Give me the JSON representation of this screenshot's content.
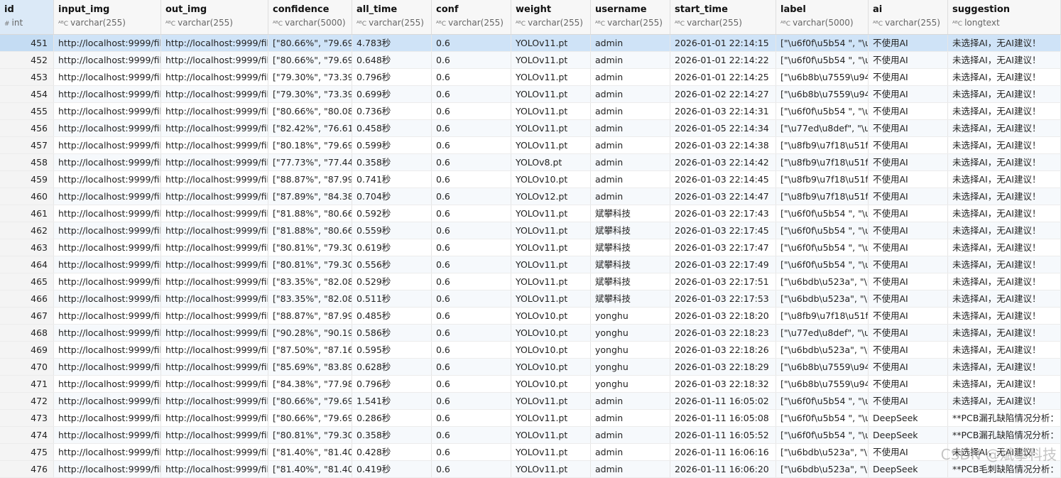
{
  "columns": [
    {
      "name": "id",
      "type": "int",
      "icon": "#"
    },
    {
      "name": "input_img",
      "type": "varchar(255)",
      "icon": "ᴬᴮC"
    },
    {
      "name": "out_img",
      "type": "varchar(255)",
      "icon": "ᴬᴮC"
    },
    {
      "name": "confidence",
      "type": "varchar(5000)",
      "icon": "ᴬᴮC"
    },
    {
      "name": "all_time",
      "type": "varchar(255)",
      "icon": "ᴬᴮC"
    },
    {
      "name": "conf",
      "type": "varchar(255)",
      "icon": "ᴬᴮC"
    },
    {
      "name": "weight",
      "type": "varchar(255)",
      "icon": "ᴬᴮC"
    },
    {
      "name": "username",
      "type": "varchar(255)",
      "icon": "ᴬᴮC"
    },
    {
      "name": "start_time",
      "type": "varchar(255)",
      "icon": "ᴬᴮC"
    },
    {
      "name": "label",
      "type": "varchar(5000)",
      "icon": "ᴬᴮC"
    },
    {
      "name": "ai",
      "type": "varchar(255)",
      "icon": "ᴬᴮC"
    },
    {
      "name": "suggestion",
      "type": "longtext",
      "icon": "ᴬᴮC"
    }
  ],
  "rows": [
    [
      "451",
      "http://localhost:9999/file",
      "http://localhost:9999/file",
      "[\"80.66%\", \"79.69%",
      "4.783秒",
      "0.6",
      "YOLOv11.pt",
      "admin",
      "2026-01-01 22:14:15",
      "[\"\\u6f0f\\u5b54 \", \"\\u6",
      "不使用AI",
      "未选择AI，无AI建议！"
    ],
    [
      "452",
      "http://localhost:9999/file",
      "http://localhost:9999/file",
      "[\"80.66%\", \"79.69%",
      "0.648秒",
      "0.6",
      "YOLOv11.pt",
      "admin",
      "2026-01-01 22:14:22",
      "[\"\\u6f0f\\u5b54 \", \"\\u6",
      "不使用AI",
      "未选择AI，无AI建议！"
    ],
    [
      "453",
      "http://localhost:9999/file",
      "http://localhost:9999/file",
      "[\"79.30%\", \"73.39%",
      "0.796秒",
      "0.6",
      "YOLOv11.pt",
      "admin",
      "2026-01-01 22:14:25",
      "[\"\\u6b8b\\u7559\\u94",
      "不使用AI",
      "未选择AI，无AI建议！"
    ],
    [
      "454",
      "http://localhost:9999/file",
      "http://localhost:9999/file",
      "[\"79.30%\", \"73.39%",
      "0.699秒",
      "0.6",
      "YOLOv11.pt",
      "admin",
      "2026-01-02 22:14:27",
      "[\"\\u6b8b\\u7559\\u94",
      "不使用AI",
      "未选择AI，无AI建议！"
    ],
    [
      "455",
      "http://localhost:9999/file",
      "http://localhost:9999/file",
      "[\"80.66%\", \"80.08%",
      "0.736秒",
      "0.6",
      "YOLOv11.pt",
      "admin",
      "2026-01-03 22:14:31",
      "[\"\\u6f0f\\u5b54 \", \"\\u6",
      "不使用AI",
      "未选择AI，无AI建议！"
    ],
    [
      "456",
      "http://localhost:9999/file",
      "http://localhost:9999/file",
      "[\"82.42%\", \"76.61%",
      "0.458秒",
      "0.6",
      "YOLOv11.pt",
      "admin",
      "2026-01-05 22:14:34",
      "[\"\\u77ed\\u8def\", \"\\u7",
      "不使用AI",
      "未选择AI，无AI建议！"
    ],
    [
      "457",
      "http://localhost:9999/file",
      "http://localhost:9999/file",
      "[\"80.18%\", \"79.69%",
      "0.599秒",
      "0.6",
      "YOLOv11.pt",
      "admin",
      "2026-01-03 22:14:38",
      "[\"\\u8fb9\\u7f18\\u51f9",
      "不使用AI",
      "未选择AI，无AI建议！"
    ],
    [
      "458",
      "http://localhost:9999/file",
      "http://localhost:9999/file",
      "[\"77.73%\", \"77.44%",
      "0.358秒",
      "0.6",
      "YOLOv8.pt",
      "admin",
      "2026-01-03 22:14:42",
      "[\"\\u8fb9\\u7f18\\u51f9",
      "不使用AI",
      "未选择AI，无AI建议！"
    ],
    [
      "459",
      "http://localhost:9999/file",
      "http://localhost:9999/file",
      "[\"88.87%\", \"87.99%",
      "0.741秒",
      "0.6",
      "YOLOv10.pt",
      "admin",
      "2026-01-03 22:14:45",
      "[\"\\u8fb9\\u7f18\\u51f9",
      "不使用AI",
      "未选择AI，无AI建议！"
    ],
    [
      "460",
      "http://localhost:9999/file",
      "http://localhost:9999/file",
      "[\"87.89%\", \"84.38%",
      "0.704秒",
      "0.6",
      "YOLOv12.pt",
      "admin",
      "2026-01-03 22:14:47",
      "[\"\\u8fb9\\u7f18\\u51f9",
      "不使用AI",
      "未选择AI，无AI建议！"
    ],
    [
      "461",
      "http://localhost:9999/file",
      "http://localhost:9999/file",
      "[\"81.88%\", \"80.66%",
      "0.592秒",
      "0.6",
      "YOLOv11.pt",
      "斌攀科技",
      "2026-01-03 22:17:43",
      "[\"\\u6f0f\\u5b54 \", \"\\u6",
      "不使用AI",
      "未选择AI，无AI建议！"
    ],
    [
      "462",
      "http://localhost:9999/file",
      "http://localhost:9999/file",
      "[\"81.88%\", \"80.66%",
      "0.559秒",
      "0.6",
      "YOLOv11.pt",
      "斌攀科技",
      "2026-01-03 22:17:45",
      "[\"\\u6f0f\\u5b54 \", \"\\u6",
      "不使用AI",
      "未选择AI，无AI建议！"
    ],
    [
      "463",
      "http://localhost:9999/file",
      "http://localhost:9999/file",
      "[\"80.81%\", \"79.30%",
      "0.619秒",
      "0.6",
      "YOLOv11.pt",
      "斌攀科技",
      "2026-01-03 22:17:47",
      "[\"\\u6f0f\\u5b54 \", \"\\u6",
      "不使用AI",
      "未选择AI，无AI建议！"
    ],
    [
      "464",
      "http://localhost:9999/file",
      "http://localhost:9999/file",
      "[\"80.81%\", \"79.30%",
      "0.556秒",
      "0.6",
      "YOLOv11.pt",
      "斌攀科技",
      "2026-01-03 22:17:49",
      "[\"\\u6f0f\\u5b54 \", \"\\u6",
      "不使用AI",
      "未选择AI，无AI建议！"
    ],
    [
      "465",
      "http://localhost:9999/file",
      "http://localhost:9999/file",
      "[\"83.35%\", \"82.08%",
      "0.529秒",
      "0.6",
      "YOLOv11.pt",
      "斌攀科技",
      "2026-01-03 22:17:51",
      "[\"\\u6bdb\\u523a\", \"\\u",
      "不使用AI",
      "未选择AI，无AI建议！"
    ],
    [
      "466",
      "http://localhost:9999/file",
      "http://localhost:9999/file",
      "[\"83.35%\", \"82.08%",
      "0.511秒",
      "0.6",
      "YOLOv11.pt",
      "斌攀科技",
      "2026-01-03 22:17:53",
      "[\"\\u6bdb\\u523a\", \"\\u",
      "不使用AI",
      "未选择AI，无AI建议！"
    ],
    [
      "467",
      "http://localhost:9999/file",
      "http://localhost:9999/file",
      "[\"88.87%\", \"87.99%",
      "0.485秒",
      "0.6",
      "YOLOv10.pt",
      "yonghu",
      "2026-01-03 22:18:20",
      "[\"\\u8fb9\\u7f18\\u51f9",
      "不使用AI",
      "未选择AI，无AI建议！"
    ],
    [
      "468",
      "http://localhost:9999/file",
      "http://localhost:9999/file",
      "[\"90.28%\", \"90.19%",
      "0.586秒",
      "0.6",
      "YOLOv10.pt",
      "yonghu",
      "2026-01-03 22:18:23",
      "[\"\\u77ed\\u8def\", \"\\u7",
      "不使用AI",
      "未选择AI，无AI建议！"
    ],
    [
      "469",
      "http://localhost:9999/file",
      "http://localhost:9999/file",
      "[\"87.50%\", \"87.16%",
      "0.595秒",
      "0.6",
      "YOLOv10.pt",
      "yonghu",
      "2026-01-03 22:18:26",
      "[\"\\u6bdb\\u523a\", \"\\u",
      "不使用AI",
      "未选择AI，无AI建议！"
    ],
    [
      "470",
      "http://localhost:9999/file",
      "http://localhost:9999/file",
      "[\"85.69%\", \"83.89%",
      "0.628秒",
      "0.6",
      "YOLOv10.pt",
      "yonghu",
      "2026-01-03 22:18:29",
      "[\"\\u6b8b\\u7559\\u94",
      "不使用AI",
      "未选择AI，无AI建议！"
    ],
    [
      "471",
      "http://localhost:9999/file",
      "http://localhost:9999/file",
      "[\"84.38%\", \"77.98%",
      "0.796秒",
      "0.6",
      "YOLOv10.pt",
      "yonghu",
      "2026-01-03 22:18:32",
      "[\"\\u6b8b\\u7559\\u94",
      "不使用AI",
      "未选择AI，无AI建议！"
    ],
    [
      "472",
      "http://localhost:9999/file",
      "http://localhost:9999/file",
      "[\"80.66%\", \"79.69%",
      "1.541秒",
      "0.6",
      "YOLOv11.pt",
      "admin",
      "2026-01-11 16:05:02",
      "[\"\\u6f0f\\u5b54 \", \"\\u6",
      "不使用AI",
      "未选择AI，无AI建议！"
    ],
    [
      "473",
      "http://localhost:9999/file",
      "http://localhost:9999/file",
      "[\"80.66%\", \"79.69%",
      "0.286秒",
      "0.6",
      "YOLOv11.pt",
      "admin",
      "2026-01-11 16:05:08",
      "[\"\\u6f0f\\u5b54 \", \"\\u6",
      "DeepSeek",
      "**PCB漏孔缺陷情况分析："
    ],
    [
      "474",
      "http://localhost:9999/file",
      "http://localhost:9999/file",
      "[\"80.81%\", \"79.30%",
      "0.358秒",
      "0.6",
      "YOLOv11.pt",
      "admin",
      "2026-01-11 16:05:52",
      "[\"\\u6f0f\\u5b54 \", \"\\u6",
      "DeepSeek",
      "**PCB漏孔缺陷情况分析："
    ],
    [
      "475",
      "http://localhost:9999/file",
      "http://localhost:9999/file",
      "[\"81.40%\", \"81.40%",
      "0.428秒",
      "0.6",
      "YOLOv11.pt",
      "admin",
      "2026-01-11 16:06:16",
      "[\"\\u6bdb\\u523a\", \"\\u",
      "不使用AI",
      "未选择AI，无AI建议！"
    ],
    [
      "476",
      "http://localhost:9999/file",
      "http://localhost:9999/file",
      "[\"81.40%\", \"81.40%",
      "0.419秒",
      "0.6",
      "YOLOv11.pt",
      "admin",
      "2026-01-11 16:06:20",
      "[\"\\u6bdb\\u523a\", \"\\u",
      "DeepSeek",
      "**PCB毛刺缺陷情况分析："
    ]
  ],
  "selected_row_index": 0,
  "watermark": "CSDN @斌攀科技"
}
